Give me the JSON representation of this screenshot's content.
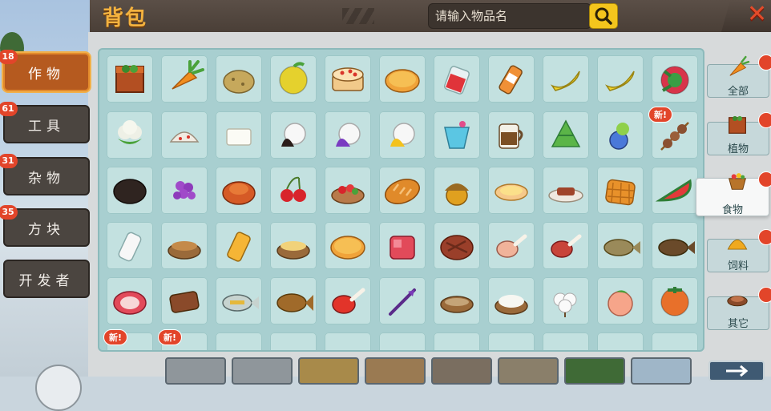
{
  "header": {
    "title": "背包",
    "search_placeholder": "请输入物品名",
    "close_label": "✕"
  },
  "tabs": [
    {
      "label": "作物",
      "count": "18",
      "active": true
    },
    {
      "label": "工具",
      "count": "61",
      "active": false
    },
    {
      "label": "杂物",
      "count": "31",
      "active": false
    },
    {
      "label": "方块",
      "count": "35",
      "active": false
    },
    {
      "label": "开发者",
      "count": "",
      "active": false
    }
  ],
  "filters": [
    {
      "label": "全部",
      "icon": "carrot-icon",
      "active": false
    },
    {
      "label": "植物",
      "icon": "crop-box-icon",
      "active": false
    },
    {
      "label": "食物",
      "icon": "food-basket-icon",
      "active": true
    },
    {
      "label": "饲料",
      "icon": "feed-pile-icon",
      "active": false
    },
    {
      "label": "其它",
      "icon": "nest-icon",
      "active": false
    }
  ],
  "new_badge_text": "新!",
  "items": [
    [
      "crop-box",
      "carrot",
      "potato",
      "lemon",
      "cake",
      "pie",
      "red-juice",
      "bottled-drink",
      "banana",
      "banana",
      "watermelon-candy"
    ],
    [
      "cauliflower",
      "dumpling",
      "tofu",
      "rice-ball-dark",
      "rice-ball-purple",
      "rice-ball-yellow",
      "blue-drink",
      "coffee-mug",
      "zongzi",
      "blueberry-cup",
      "skewer"
    ],
    [
      "burnt-food",
      "grapes",
      "roast-turkey",
      "cherry",
      "fruit-salad",
      "bread",
      "acorn",
      "egg-tart",
      "meat-plate",
      "waffle",
      "watermelon-slice"
    ],
    [
      "milk-bottle",
      "stew-bowl",
      "orange-juice",
      "noodle-bowl",
      "pizza",
      "raw-meat",
      "steak",
      "drumstick",
      "drumstick-raw",
      "grilled-fish",
      "grilled-fish-dark"
    ],
    [
      "ham-slice",
      "roast-beef",
      "raw-fish",
      "fried-fish",
      "leg-of-meat",
      "arrow-feather",
      "empty-bowl",
      "rice-bowl",
      "cotton",
      "peach",
      "persimmon"
    ]
  ],
  "new_items": [
    "skewer"
  ],
  "hotbar": {
    "next_label": "→"
  }
}
